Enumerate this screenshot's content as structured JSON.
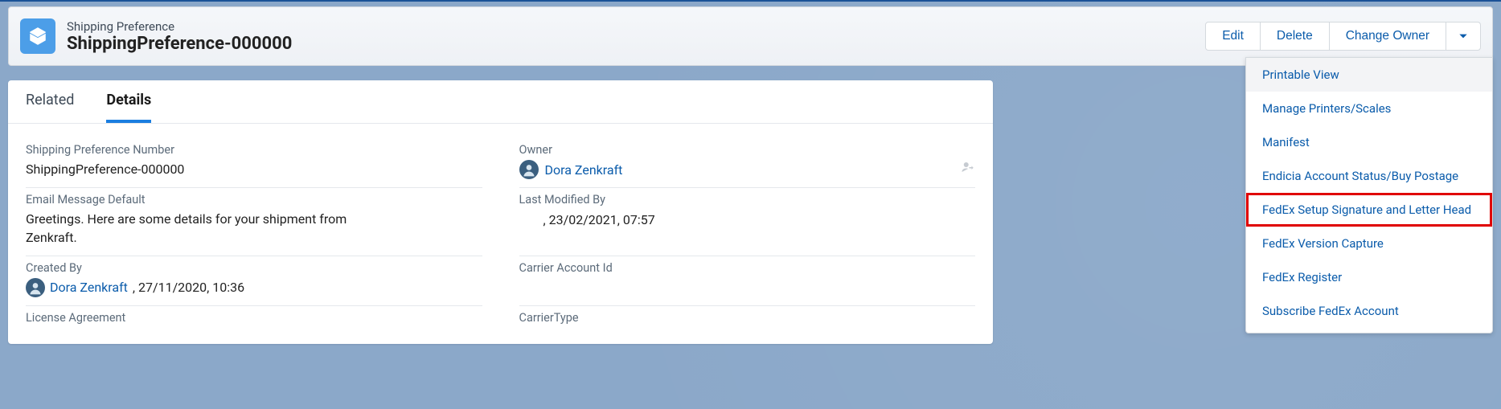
{
  "header": {
    "object_label": "Shipping Preference",
    "title": "ShippingPreference-000000",
    "actions": {
      "edit": "Edit",
      "delete": "Delete",
      "change_owner": "Change Owner"
    }
  },
  "dropdown": {
    "items": [
      "Printable View",
      "Manage Printers/Scales",
      "Manifest",
      "Endicia Account Status/Buy Postage",
      "FedEx Setup Signature and Letter Head",
      "FedEx Version Capture",
      "FedEx Register",
      "Subscribe FedEx Account"
    ],
    "highlight_index": 4
  },
  "tabs": {
    "related": "Related",
    "details": "Details"
  },
  "fields": {
    "sp_number": {
      "label": "Shipping Preference Number",
      "value": "ShippingPreference-000000"
    },
    "owner": {
      "label": "Owner",
      "value": "Dora Zenkraft"
    },
    "email_default": {
      "label": "Email Message Default",
      "value": "Greetings. Here are some details for your shipment from Zenkraft."
    },
    "last_modified": {
      "label": "Last Modified By",
      "value": ", 23/02/2021, 07:57"
    },
    "created_by": {
      "label": "Created By",
      "user": "Dora Zenkraft",
      "timestamp": ", 27/11/2020, 10:36"
    },
    "carrier_account": {
      "label": "Carrier Account Id",
      "value": ""
    },
    "license": {
      "label": "License Agreement"
    },
    "carrier_type": {
      "label": "CarrierType"
    }
  }
}
